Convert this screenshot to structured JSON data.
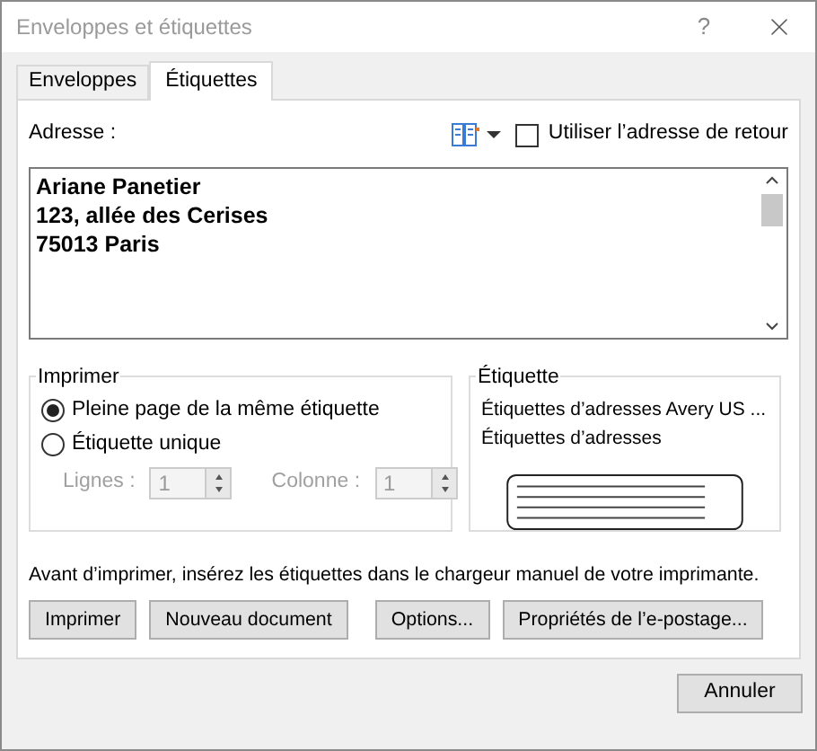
{
  "window": {
    "title": "Enveloppes et étiquettes",
    "help": "?"
  },
  "tabs": [
    {
      "label": "Enveloppes",
      "selected": false
    },
    {
      "label": "Étiquettes",
      "selected": true
    }
  ],
  "address": {
    "label": "Adresse :",
    "lines": [
      "Ariane Panetier",
      "123, allée des Cerises",
      "75013 Paris"
    ],
    "return_checkbox": {
      "label": "Utiliser l’adresse de retour",
      "checked": false
    }
  },
  "print_group": {
    "title": "Imprimer",
    "options": [
      {
        "label": "Pleine page de la même étiquette",
        "selected": true
      },
      {
        "label": "Étiquette unique",
        "selected": false
      }
    ],
    "spinners": [
      {
        "label": "Lignes :",
        "value": "1",
        "disabled": true
      },
      {
        "label": "Colonne :",
        "value": "1",
        "disabled": true
      }
    ]
  },
  "label_group": {
    "title": "Étiquette",
    "lines": [
      "Étiquettes d’adresses Avery US ...",
      "Étiquettes d’adresses"
    ]
  },
  "note": "Avant d’imprimer, insérez les étiquettes dans le chargeur manuel de votre imprimante.",
  "buttons": [
    "Imprimer",
    "Nouveau document",
    "Options...",
    "Propriétés de l’e-postage..."
  ],
  "footer_buttons": [
    "Annuler"
  ]
}
